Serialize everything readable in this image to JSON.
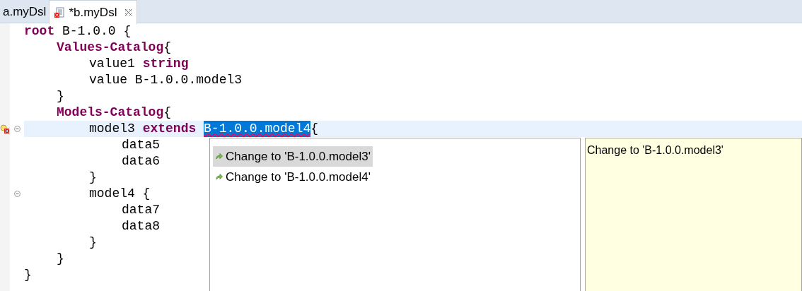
{
  "tabs": [
    {
      "label": "a.myDsl",
      "selected": false,
      "dirty_icon": false,
      "closable": false
    },
    {
      "label": "*b.myDsl",
      "selected": true,
      "dirty_icon": true,
      "closable": true
    }
  ],
  "lines": [
    {
      "tokens": [
        {
          "kind": "keyword",
          "text": "root"
        },
        {
          "kind": "plain",
          "text": " B-1.0.0 {"
        }
      ],
      "children": [
        {
          "tokens": [
            {
              "kind": "keyword",
              "text": "Values-Catalog"
            },
            {
              "kind": "plain",
              "text": "{"
            }
          ],
          "children": [
            {
              "tokens": [
                {
                  "kind": "plain",
                  "text": "value1 "
                },
                {
                  "kind": "keyword",
                  "text": "string"
                }
              ]
            },
            {
              "tokens": [
                {
                  "kind": "plain",
                  "text": "value B-1.0.0.model3"
                }
              ]
            }
          ]
        },
        {
          "tokens": [
            {
              "kind": "plain",
              "text": "}"
            }
          ]
        },
        {
          "tokens": [
            {
              "kind": "keyword",
              "text": "Models-Catalog"
            },
            {
              "kind": "plain",
              "text": "{"
            }
          ],
          "children": [
            {
              "tokens": [
                {
                  "kind": "plain",
                  "text": "model3 "
                },
                {
                  "kind": "keyword",
                  "text": "extends "
                },
                {
                  "kind": "plain",
                  "text": "B-1.0.0.model4",
                  "selected": true,
                  "error": true
                },
                {
                  "kind": "plain",
                  "text": "{"
                }
              ],
              "current": true,
              "error_marker": true,
              "foldable": true,
              "children": [
                {
                  "tokens": [
                    {
                      "kind": "plain",
                      "text": "data5"
                    }
                  ]
                },
                {
                  "tokens": [
                    {
                      "kind": "plain",
                      "text": "data6"
                    }
                  ]
                }
              ]
            },
            {
              "tokens": [
                {
                  "kind": "plain",
                  "text": "}"
                }
              ]
            },
            {
              "tokens": [
                {
                  "kind": "plain",
                  "text": "model4 {"
                }
              ],
              "foldable": true,
              "children": [
                {
                  "tokens": [
                    {
                      "kind": "plain",
                      "text": "data7"
                    }
                  ]
                },
                {
                  "tokens": [
                    {
                      "kind": "plain",
                      "text": "data8"
                    }
                  ]
                }
              ]
            },
            {
              "tokens": [
                {
                  "kind": "plain",
                  "text": "}"
                }
              ]
            }
          ]
        },
        {
          "tokens": [
            {
              "kind": "plain",
              "text": "}"
            }
          ]
        }
      ]
    },
    {
      "tokens": [
        {
          "kind": "plain",
          "text": "}"
        }
      ]
    }
  ],
  "proposals": [
    {
      "label": "Change to 'B-1.0.0.model3'",
      "selected": true
    },
    {
      "label": "Change to 'B-1.0.0.model4'",
      "selected": false
    }
  ],
  "info": {
    "text": "Change to 'B-1.0.0.model3'"
  }
}
